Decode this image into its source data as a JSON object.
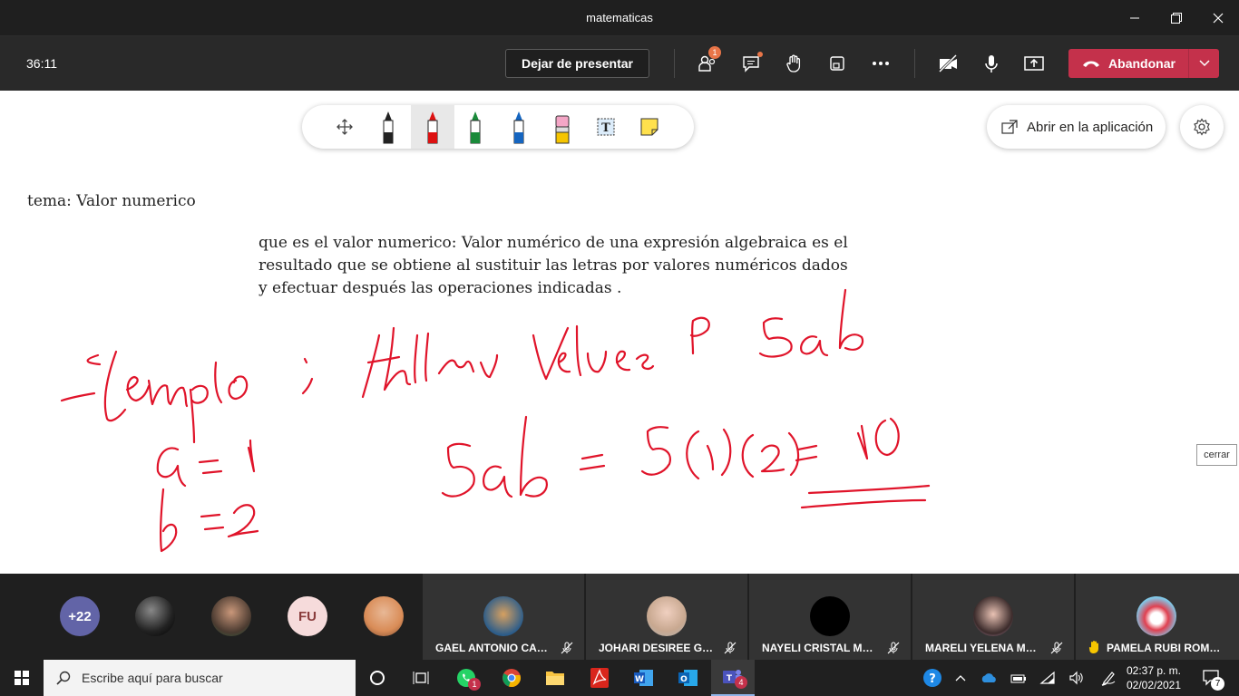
{
  "window": {
    "title": "matematicas"
  },
  "meeting": {
    "timer": "36:11",
    "stop_presenting": "Dejar de presentar",
    "participants_badge": "1",
    "leave_label": "Abandonar",
    "leave_color": "#c4314b"
  },
  "whiteboard": {
    "open_in_app": "Abrir en la aplicación",
    "tools": [
      "move-icon",
      "black-pen-icon",
      "red-pen-icon",
      "green-pen-icon",
      "blue-pen-icon",
      "eraser-icon",
      "text-tool-icon",
      "sticky-note-icon"
    ],
    "selected_tool": "red-pen-icon",
    "topic": "tema: Valor numerico",
    "definition": [
      "que es el valor numerico: Valor numérico de una expresión algebraica es el",
      "resultado que se obtiene al sustituir las letras por valores numéricos dados",
      "y efectuar después las operaciones indicadas ."
    ],
    "close_tooltip": "cerrar"
  },
  "participants": {
    "overflow_count": "+22",
    "initials_avatar": "FU",
    "tiles": [
      {
        "name": "GAEL ANTONIO CAST...",
        "raised_hand": false
      },
      {
        "name": "JOHARI DESIREE GUIL...",
        "raised_hand": false
      },
      {
        "name": "NAYELI CRISTAL MEZA...",
        "raised_hand": false
      },
      {
        "name": "MARELI YELENA MEN...",
        "raised_hand": false
      },
      {
        "name": "PAMELA RUBI ROMER...",
        "raised_hand": true
      }
    ]
  },
  "taskbar": {
    "search_placeholder": "Escribe aquí para buscar",
    "whatsapp_badge": "1",
    "teams_badge": "4",
    "time": "02:37 p. m.",
    "date": "02/02/2021",
    "notifications_count": "7"
  }
}
